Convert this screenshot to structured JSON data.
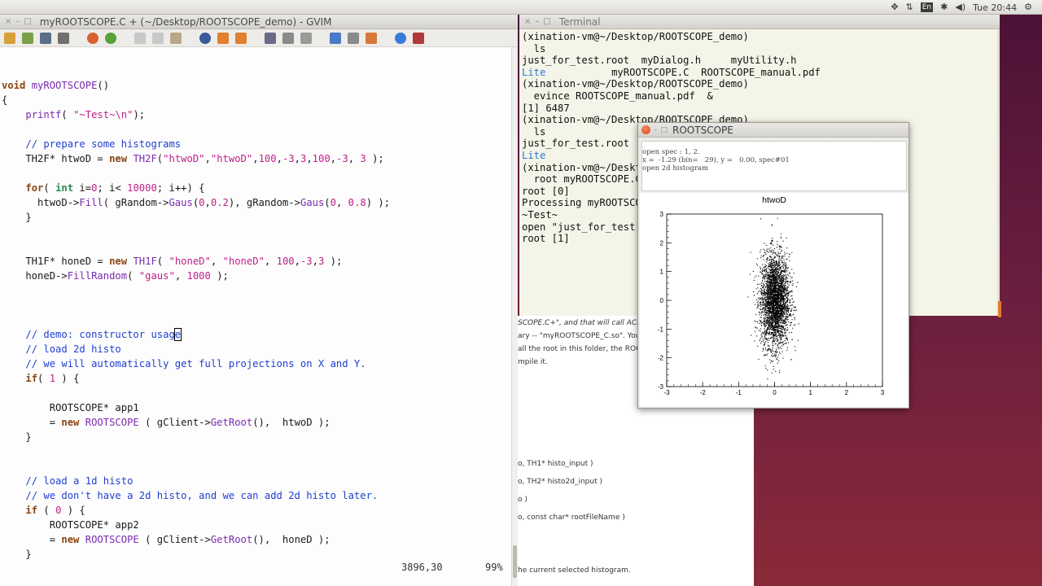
{
  "panel": {
    "keyboard": "En",
    "clock": "Tue 20:44"
  },
  "gvim": {
    "title": "myROOTSCOPE.C + (~/Desktop/ROOTSCOPE_demo) - GVIM",
    "status_position": "3896,30",
    "status_percent": "99%"
  },
  "terminal": {
    "title": "Terminal",
    "lines": [
      "(xination-vm@~/Desktop/ROOTSCOPE_demo)",
      "  ls",
      "just_for_test.root  myDialog.h     myUtility.h",
      "LITE_ROW",
      "(xination-vm@~/Desktop/ROOTSCOPE_demo)",
      "  evince ROOTSCOPE_manual.pdf  &",
      "[1] 6487",
      "(xination-vm@~/Desktop/ROOTSCOPE_demo)",
      "  ls",
      "just_for_test.root",
      "LITE_ONLY",
      "(xination-vm@~/Deskt",
      "  root myROOTSCOPE.C",
      "root [0]",
      "Processing myROOTSCO",
      "~Test~",
      "open \"just_for_test.",
      "root [1] "
    ],
    "lite_label": "Lite",
    "lite_row_rest": "           myROOTSCOPE.C  ROOTSCOPE_manual.pdf"
  },
  "doc": {
    "lines": [
      "SCOPE.C+\", and that will call ACL",
      "ary -- \"myROOTSCOPE_C.so\". You",
      "all the root in this folder, the ROOT",
      "mpile it.",
      "o,  TH1* histo_input )",
      "o, TH2* histo2d_input )",
      "o )",
      "o, const char* rootFileName  )",
      "he current selected histogram."
    ]
  },
  "rootscope": {
    "title": "ROOTSCOPE",
    "info_lines": [
      "open spec : 1, 2.",
      "x =  -1.29 (bin=   29), y =   0.00, spec#01",
      "open 2d histogram"
    ]
  },
  "chart_data": {
    "type": "scatter",
    "title": "htwoD",
    "xlabel": "",
    "ylabel": "",
    "xlim": [
      -3,
      3
    ],
    "ylim": [
      -3,
      3
    ],
    "x_ticks": [
      "-3",
      "-2",
      "-1",
      "0",
      "1",
      "2",
      "3"
    ],
    "y_ticks": [
      "-3",
      "-2",
      "-1",
      "0",
      "1",
      "2",
      "3"
    ],
    "distribution": {
      "x_mean": 0,
      "x_sigma": 0.2,
      "y_mean": 0,
      "y_sigma": 0.8,
      "entries": 10000
    }
  }
}
